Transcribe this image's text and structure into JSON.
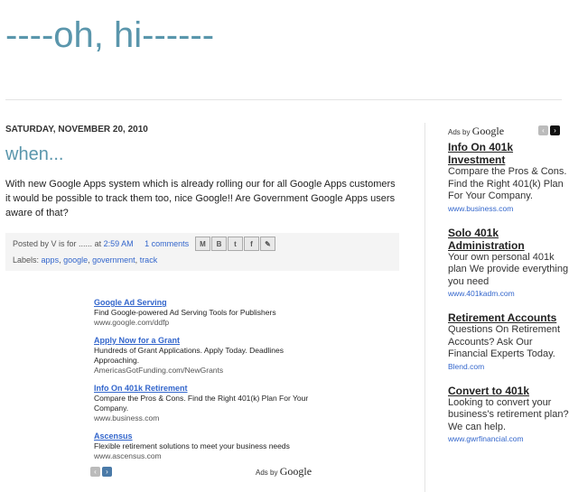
{
  "blog": {
    "title": "----oh, hi------"
  },
  "post": {
    "date": "SATURDAY, NOVEMBER 20, 2010",
    "title": "when...",
    "body": "With new Google Apps system which is already rolling our for all Google Apps customers it would be possible to track them too, nice Google!! Are Government Google Apps users aware of that?",
    "posted_by": "Posted by V is for ......",
    "at": "at",
    "time": "2:59 AM",
    "comments": "1 comments",
    "share_icons": [
      "M",
      "B",
      "t",
      "f",
      "✎"
    ],
    "labels_prefix": "Labels:",
    "labels": [
      "apps",
      "google",
      "government",
      "track"
    ]
  },
  "ads_main": {
    "items": [
      {
        "title": "Google Ad Serving",
        "desc": "Find Google-powered Ad Serving Tools for Publishers",
        "url": "www.google.com/ddfp"
      },
      {
        "title": "Apply Now for a Grant",
        "desc": "Hundreds of Grant Applications. Apply Today. Deadlines Approaching.",
        "url": "AmericasGotFunding.com/NewGrants"
      },
      {
        "title": "Info On 401k Retirement",
        "desc": "Compare the Pros & Cons. Find the Right 401(k) Plan For Your Company.",
        "url": "www.business.com"
      },
      {
        "title": "Ascensus",
        "desc": "Flexible retirement solutions to meet your business needs",
        "url": "www.ascensus.com"
      }
    ],
    "ads_by": "Ads by",
    "google": "Google",
    "prev": "‹",
    "next": "›"
  },
  "ads_side": {
    "ads_by": "Ads by",
    "google": "Google",
    "prev": "‹",
    "next": "›",
    "items": [
      {
        "title": "Info On 401k Investment",
        "desc": "Compare the Pros & Cons. Find the Right 401(k) Plan For Your Company.",
        "url": "www.business.com"
      },
      {
        "title": "Solo 401k Administration",
        "desc": "Your own personal 401k plan We provide everything you need",
        "url": "www.401kadm.com"
      },
      {
        "title": "Retirement Accounts",
        "desc": "Questions On Retirement Accounts? Ask Our Financial Experts Today.",
        "url": "Blend.com"
      },
      {
        "title": "Convert to 401k",
        "desc": "Looking to convert your business's retirement plan? We can help.",
        "url": "www.gwrfinancial.com"
      }
    ]
  }
}
